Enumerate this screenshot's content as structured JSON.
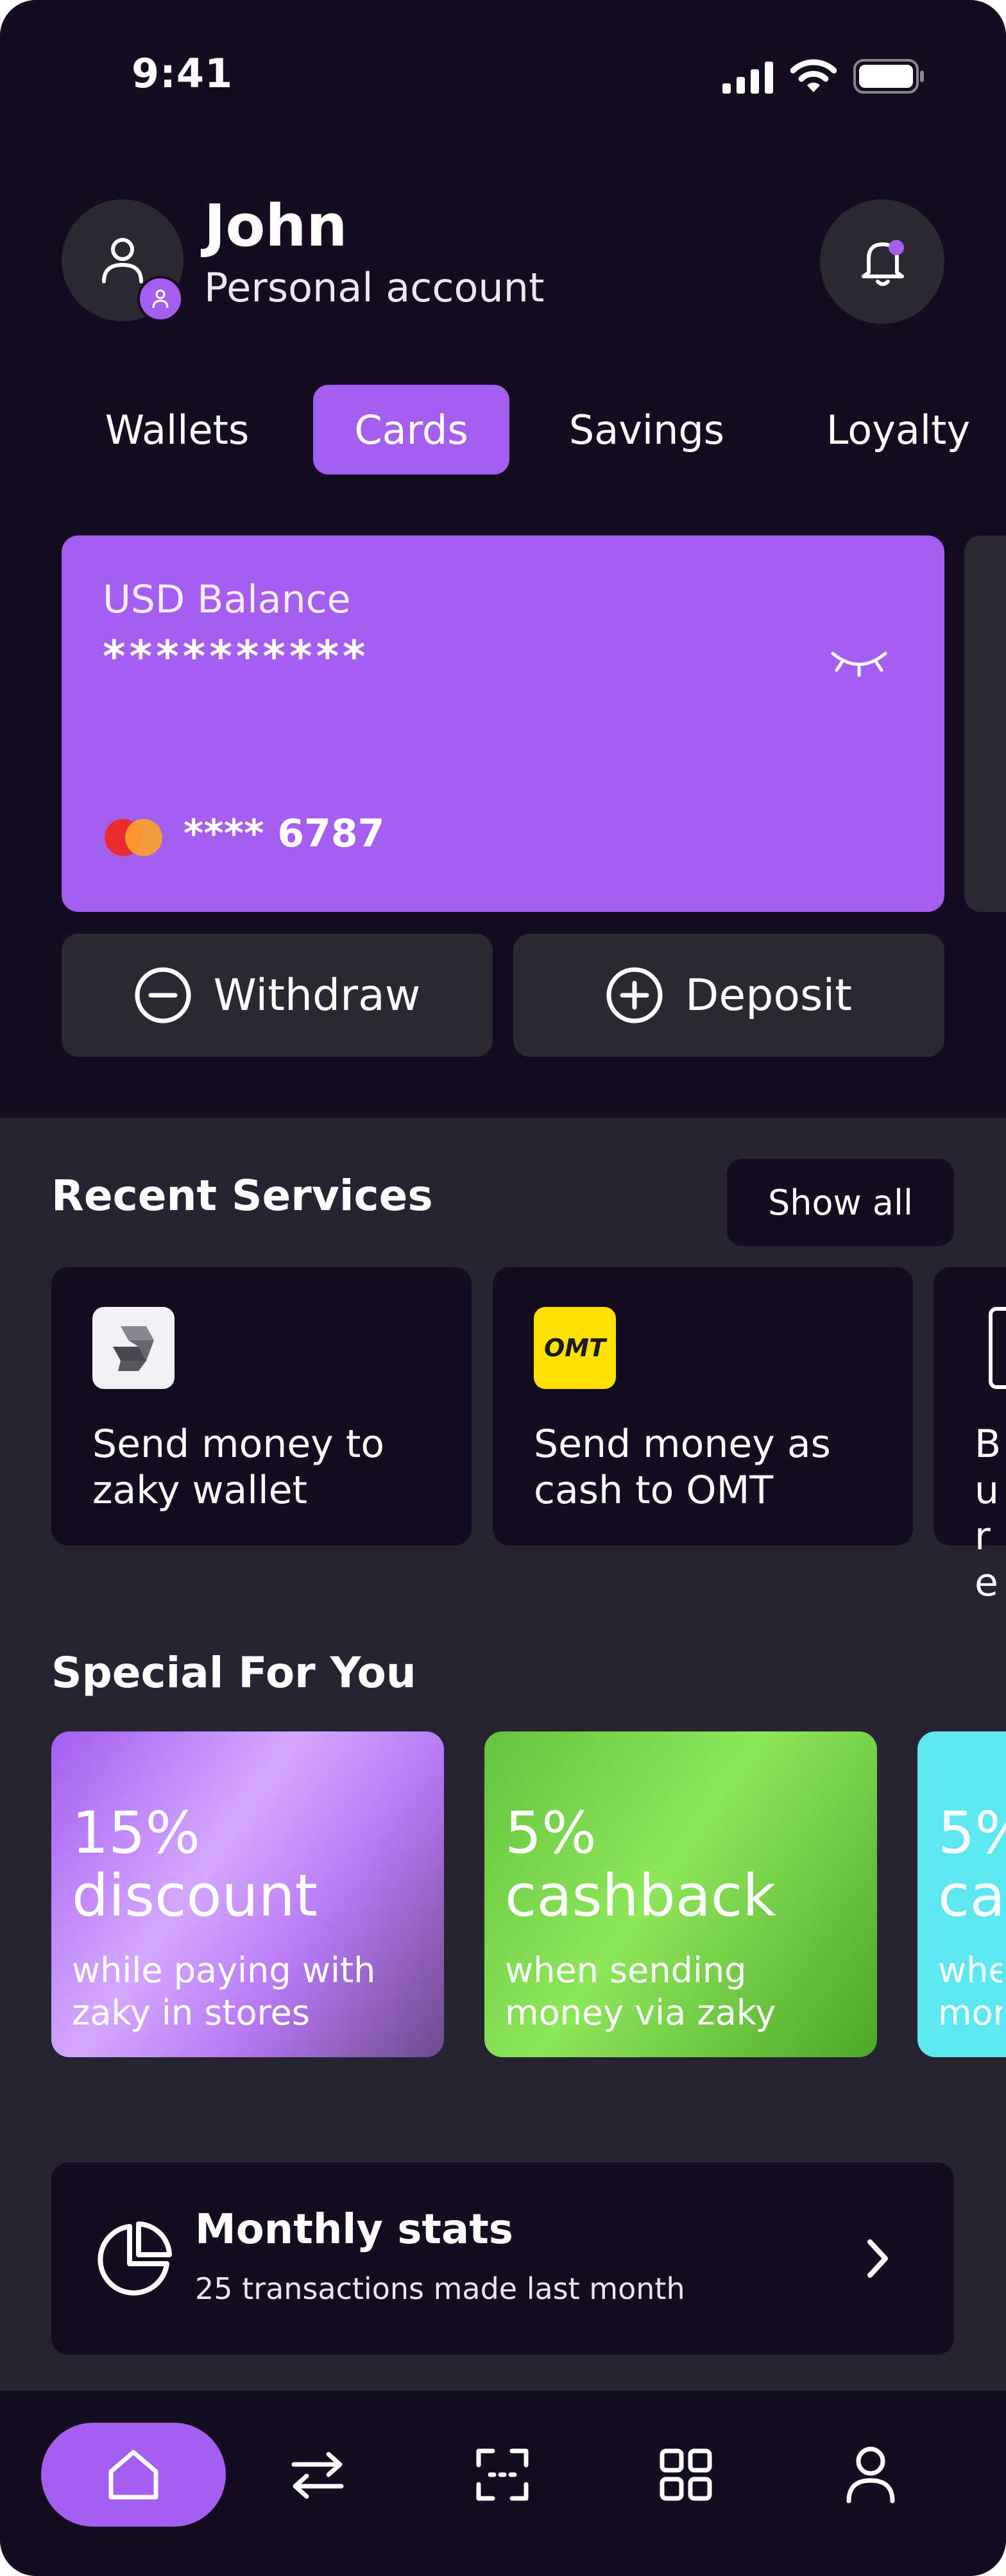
{
  "status_bar": {
    "time": "9:41"
  },
  "header": {
    "name": "John",
    "account_type": "Personal account",
    "avatar_icon": "user-icon",
    "badge_icon": "user-icon",
    "notification_icon": "bell-icon"
  },
  "tabs": [
    {
      "label": "Wallets",
      "active": false
    },
    {
      "label": "Cards",
      "active": true
    },
    {
      "label": "Savings",
      "active": false
    },
    {
      "label": "Loyalty",
      "active": false
    }
  ],
  "card": {
    "balance_label": "USD Balance",
    "balance_masked": "**********",
    "card_number": "**** 6787",
    "visibility_icon": "eye-closed-icon",
    "brand_icon": "mastercard-icon"
  },
  "actions": {
    "withdraw": "Withdraw",
    "deposit": "Deposit"
  },
  "recent_services": {
    "title": "Recent Services",
    "show_all": "Show all",
    "items": [
      {
        "label": "Send money to zaky wallet",
        "icon": "zaky-logo-icon"
      },
      {
        "label": "Send money as cash to OMT",
        "icon": "omt-logo-icon",
        "logo_text": "OMT"
      },
      {
        "label": "Bu re",
        "icon": "service-icon"
      }
    ]
  },
  "special": {
    "title": "Special For You",
    "offers": [
      {
        "headline": "15% discount",
        "sub": "while paying with zaky in stores",
        "color": "#a55ef0"
      },
      {
        "headline": "5% cashback",
        "sub": "when sending money via zaky",
        "color": "#6ccf48"
      },
      {
        "headline": "5% ca",
        "sub": "whe mor",
        "color": "#5de8f1"
      }
    ]
  },
  "stats": {
    "title": "Monthly stats",
    "subtitle": "25 transactions made last month"
  },
  "bottom_nav": [
    "home-icon",
    "transfer-icon",
    "scan-icon",
    "apps-icon",
    "profile-icon"
  ],
  "colors": {
    "accent": "#a55ef0",
    "bg_dark": "#150c1f",
    "bg_mid": "#282332",
    "surface": "#2b2733"
  }
}
